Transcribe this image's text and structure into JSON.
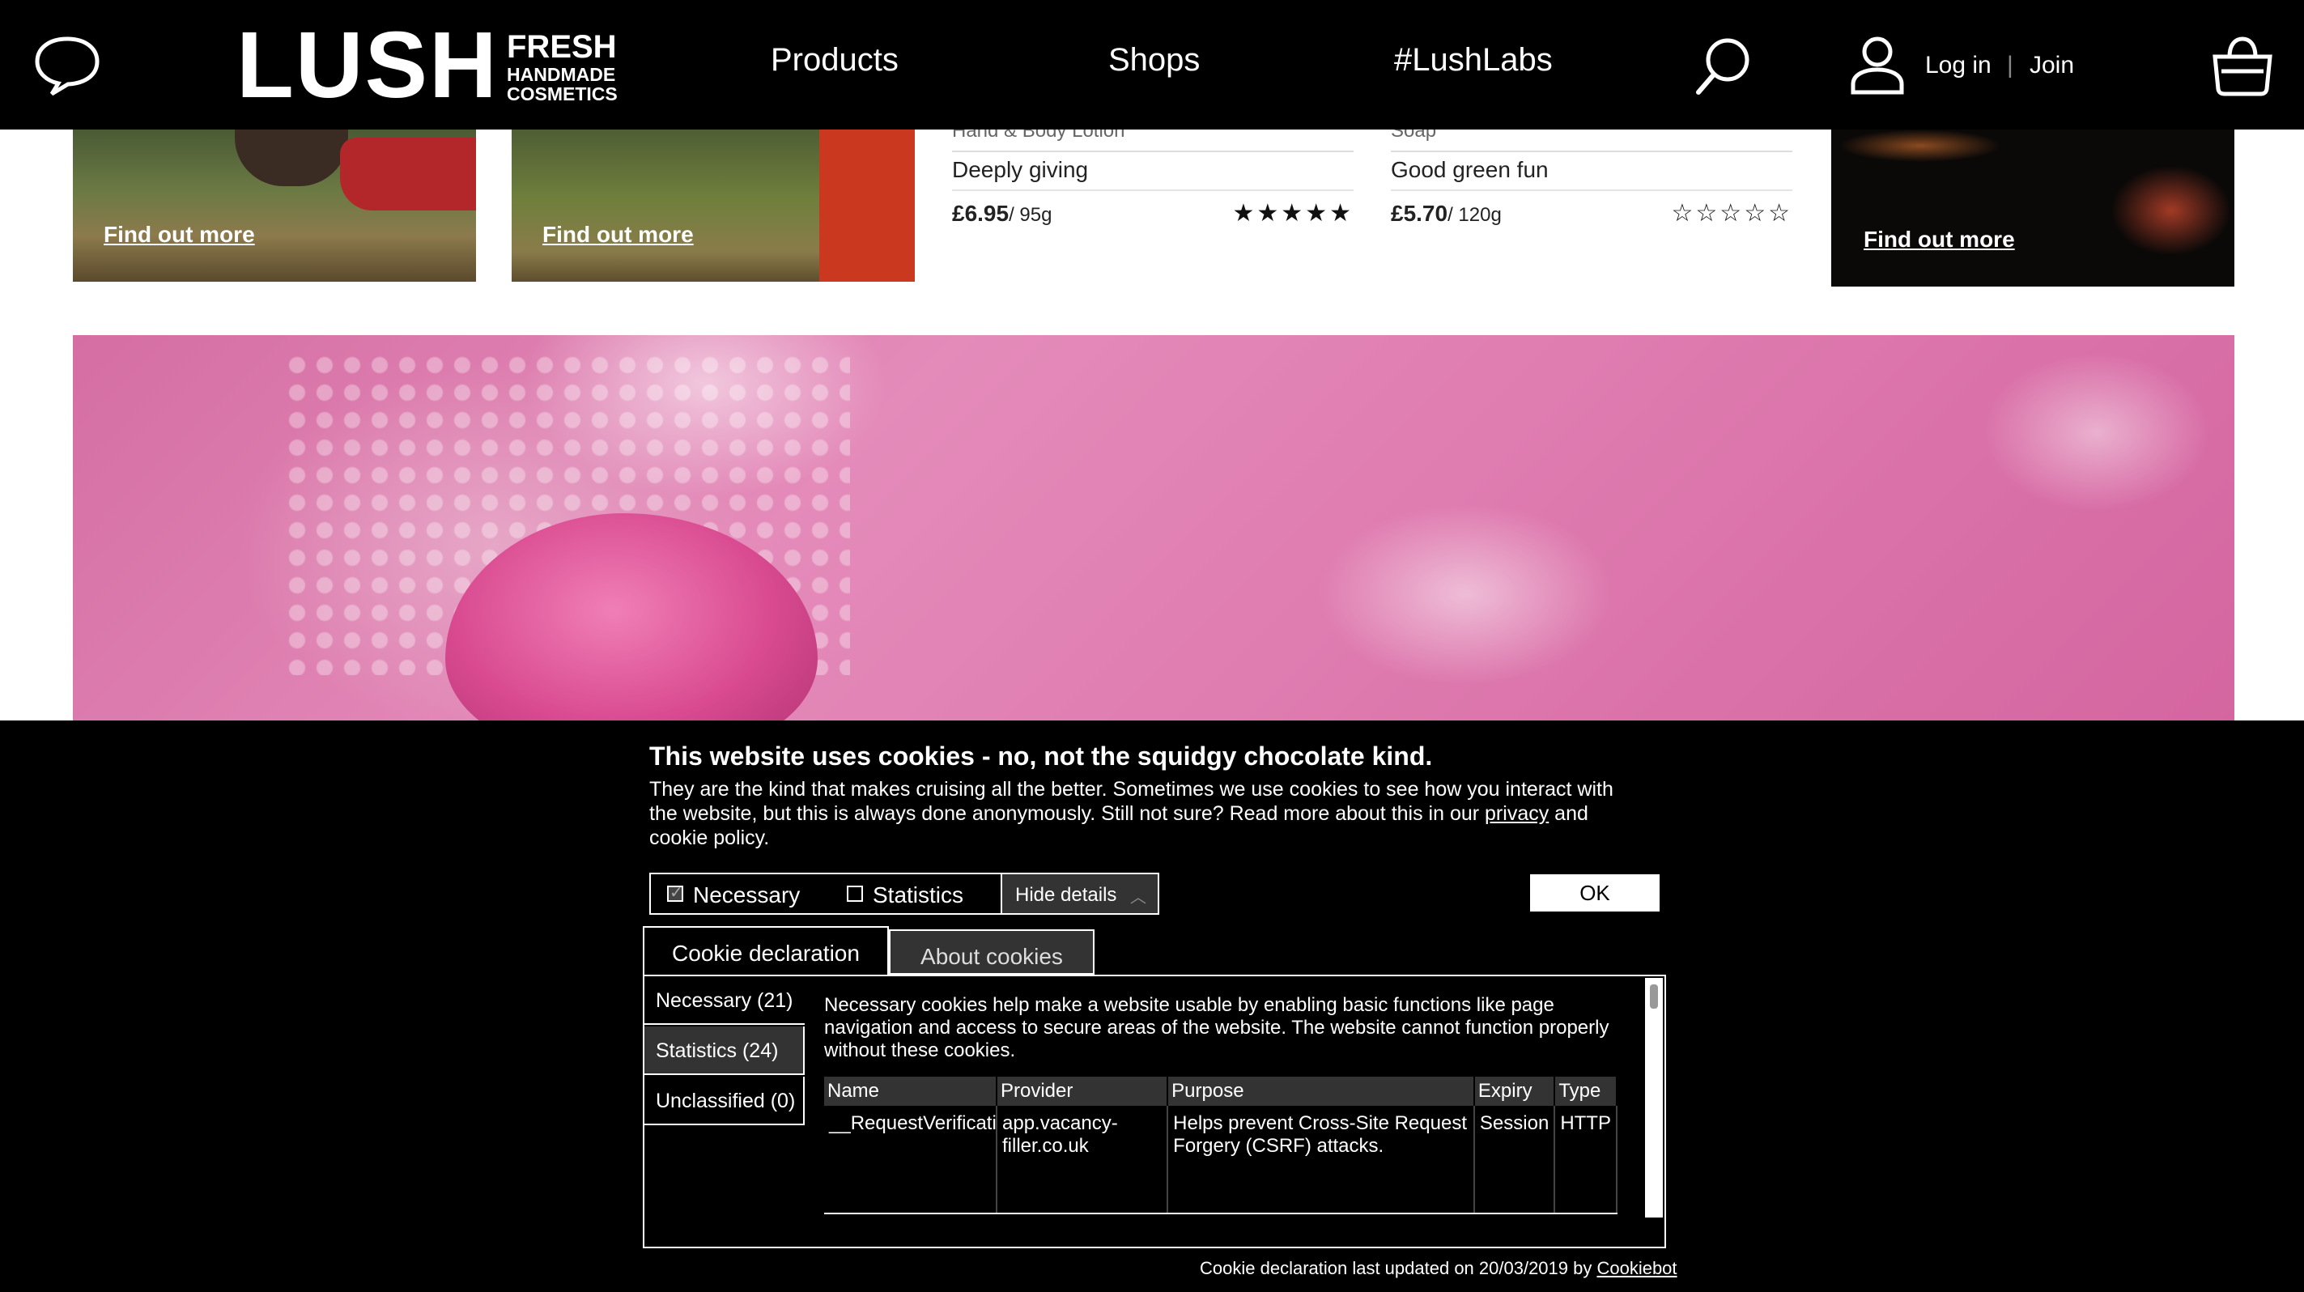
{
  "header": {
    "logo_word": "LUSH",
    "logo_tag_line1": "FRESH",
    "logo_tag_line2": "HANDMADE",
    "logo_tag_line3": "COSMETICS",
    "nav": [
      "Products",
      "Shops",
      "#LushLabs"
    ],
    "login": "Log in",
    "separator": "|",
    "join": "Join",
    "icons": [
      "chat-icon",
      "search-icon",
      "user-icon",
      "bag-icon"
    ]
  },
  "tiles": {
    "tile1_link": "Find out more",
    "tile2_link": "Find out more",
    "tile4_link": "Find out more"
  },
  "products": [
    {
      "category_cut": "Hand & Body Lotion",
      "description": "Deeply giving",
      "price": "£6.95",
      "weight": "/ 95g",
      "rating": 5
    },
    {
      "category_cut": "Soap",
      "description": "Good green fun",
      "price": "£5.70",
      "weight": "/ 120g",
      "rating": 0
    }
  ],
  "cookie": {
    "title": "This website uses cookies - no, not the squidgy chocolate kind.",
    "text_before_link": "They are the kind that makes cruising all the better. Sometimes we use cookies to see how you interact with the website, but this is always done anonymously. Still not sure? Read more about this in our ",
    "privacy_link": "privacy",
    "text_after_link": " and cookie policy.",
    "necessary_label": "Necessary",
    "statistics_label": "Statistics",
    "hide_details": "Hide details",
    "ok_label": "OK",
    "tabs": [
      "Cookie declaration",
      "About cookies"
    ],
    "side_items": [
      "Necessary (21)",
      "Statistics (24)",
      "Unclassified (0)"
    ],
    "panel_description": "Necessary cookies help make a website usable by enabling basic functions like page navigation and access to secure areas of the website. The website cannot function properly without these cookies.",
    "table": {
      "headers": [
        "Name",
        "Provider",
        "Purpose",
        "Expiry",
        "Type"
      ],
      "rows": [
        [
          "__RequestVerificati",
          "app.vacancy-filler.co.uk",
          "Helps prevent Cross-Site Request Forgery (CSRF) attacks.",
          "Session",
          "HTTP"
        ]
      ]
    },
    "footer_text": "Cookie declaration last updated on 20/03/2019 by ",
    "footer_link": "Cookiebot"
  }
}
